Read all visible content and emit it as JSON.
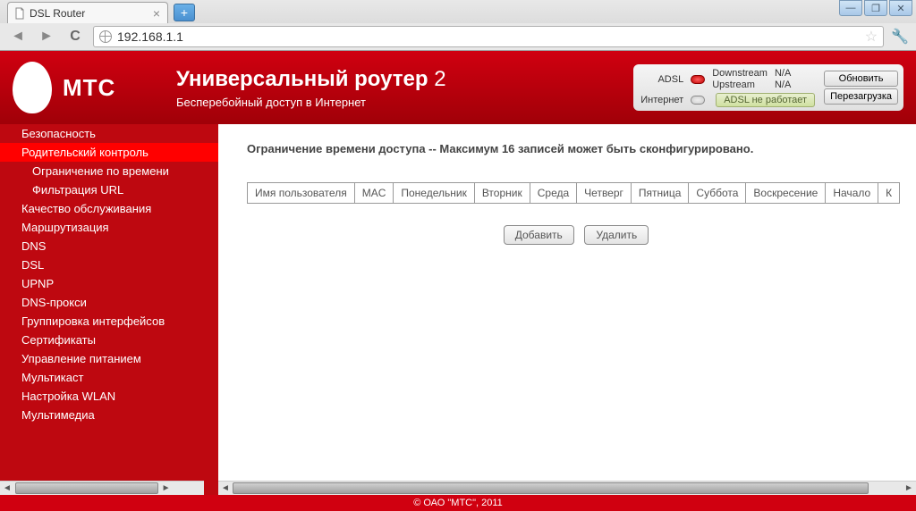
{
  "browser": {
    "tab_title": "DSL Router",
    "url": "192.168.1.1"
  },
  "header": {
    "brand": "МТС",
    "title_main": "Универсальный роутер",
    "title_num": "2",
    "subtitle": "Бесперебойный доступ в Интернет",
    "status": {
      "adsl_label": "ADSL",
      "internet_label": "Интернет",
      "downstream": "Downstream",
      "upstream": "Upstream",
      "na1": "N/A",
      "na2": "N/A",
      "adsl_fail": "ADSL не работает",
      "refresh": "Обновить",
      "reboot": "Перезагрузка"
    }
  },
  "sidebar": {
    "items": [
      {
        "label": "Безопасность",
        "lvl": 1,
        "active": false
      },
      {
        "label": "Родительский контроль",
        "lvl": 1,
        "active": true
      },
      {
        "label": "Ограничение по времени",
        "lvl": 2,
        "active": false
      },
      {
        "label": "Фильтрация URL",
        "lvl": 2,
        "active": false
      },
      {
        "label": "Качество обслуживания",
        "lvl": 1,
        "active": false
      },
      {
        "label": "Маршрутизация",
        "lvl": 1,
        "active": false
      },
      {
        "label": "DNS",
        "lvl": 1,
        "active": false
      },
      {
        "label": "DSL",
        "lvl": 1,
        "active": false
      },
      {
        "label": "UPNP",
        "lvl": 1,
        "active": false
      },
      {
        "label": "DNS-прокси",
        "lvl": 1,
        "active": false
      },
      {
        "label": "Группировка интерфейсов",
        "lvl": 1,
        "active": false
      },
      {
        "label": "Сертификаты",
        "lvl": 1,
        "active": false
      },
      {
        "label": "Управление питанием",
        "lvl": 1,
        "active": false
      },
      {
        "label": "Мультикаст",
        "lvl": 1,
        "active": false
      },
      {
        "label": "Настройка WLAN",
        "lvl": 0,
        "active": false
      },
      {
        "label": "Мультимедиа",
        "lvl": 0,
        "active": false
      }
    ]
  },
  "content": {
    "heading": "Ограничение времени доступа -- Максимум 16 записей может быть сконфигурировано.",
    "columns": [
      "Имя пользователя",
      "MAC",
      "Понедельник",
      "Вторник",
      "Среда",
      "Четверг",
      "Пятница",
      "Суббота",
      "Воскресение",
      "Начало",
      "К"
    ],
    "add_btn": "Добавить",
    "del_btn": "Удалить"
  },
  "footer": "© ОАО \"МТС\", 2011"
}
